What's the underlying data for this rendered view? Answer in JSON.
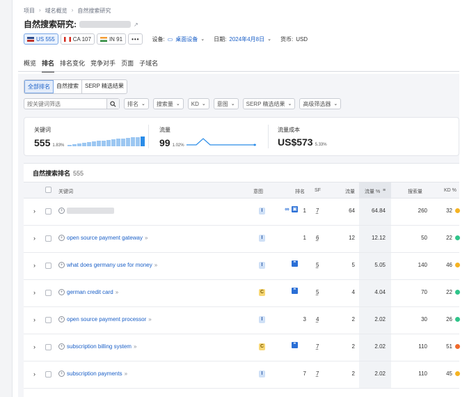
{
  "breadcrumb": [
    "项目",
    "域名概览",
    "自然搜索研究"
  ],
  "title": "自然搜索研究:",
  "databases": [
    {
      "label": "US 555",
      "flag": "us",
      "active": true
    },
    {
      "label": "CA 107",
      "flag": "ca",
      "active": false
    },
    {
      "label": "IN 91",
      "flag": "in",
      "active": false
    }
  ],
  "more_label": "•••",
  "device": {
    "label": "设备:",
    "value": "桌面设备"
  },
  "date": {
    "label": "日期:",
    "value": "2024年4月8日"
  },
  "currency": {
    "label": "货币:",
    "value": "USD"
  },
  "tabs": [
    "概览",
    "排名",
    "排名变化",
    "竞争对手",
    "页面",
    "子域名"
  ],
  "active_tab": "排名",
  "segments": [
    "全部排名",
    "自然搜索",
    "SERP 精选结果"
  ],
  "search_placeholder": "按关键词筛选",
  "filters": [
    "排名",
    "搜索量",
    "KD",
    "意图",
    "SERP 精选结果",
    "高级筛选器"
  ],
  "summary": {
    "keywords": {
      "label": "关键词",
      "value": "555",
      "pct": "1.83%",
      "bar_levels": [
        0.15,
        0.2,
        0.3,
        0.35,
        0.45,
        0.5,
        0.55,
        0.6,
        0.65,
        0.7,
        0.75,
        0.8,
        0.85,
        0.9,
        0.95,
        1.0
      ]
    },
    "traffic": {
      "label": "流量",
      "value": "99",
      "pct": "1.02%"
    },
    "traffic_cost": {
      "label": "流量成本",
      "value": "US$573",
      "pct": "5.33%"
    }
  },
  "table": {
    "title": "自然搜索排名",
    "count": "555",
    "headers": {
      "keyword": "关键词",
      "intent": "意图",
      "position": "排名",
      "sf": "SF",
      "traffic": "流量",
      "traffic_pct": "流量 %",
      "volume": "搜索量",
      "kd": "KD %"
    },
    "rows": [
      {
        "keyword": "",
        "blurred": true,
        "intent": "I",
        "sf_icons": [
          "link",
          "image"
        ],
        "position": "1",
        "sf": "7",
        "traffic": "64",
        "traffic_pct": "64.84",
        "volume": "260",
        "kd": "32",
        "kd_color": "#f5b323"
      },
      {
        "keyword": "open source payment gateway",
        "blurred": false,
        "intent": "I",
        "sf_icons": [],
        "position": "1",
        "sf": "6",
        "traffic": "12",
        "traffic_pct": "12.12",
        "volume": "50",
        "kd": "22",
        "kd_color": "#2fc48a"
      },
      {
        "keyword": "what does germany use for money",
        "blurred": false,
        "intent": "I",
        "sf_icons": [
          "quote"
        ],
        "position": "",
        "sf": "5",
        "traffic": "5",
        "traffic_pct": "5.05",
        "volume": "140",
        "kd": "46",
        "kd_color": "#f5b323"
      },
      {
        "keyword": "german credit card",
        "blurred": false,
        "intent": "C",
        "sf_icons": [
          "quote"
        ],
        "position": "",
        "sf": "5",
        "traffic": "4",
        "traffic_pct": "4.04",
        "volume": "70",
        "kd": "22",
        "kd_color": "#2fc48a"
      },
      {
        "keyword": "open source payment processor",
        "blurred": false,
        "intent": "I",
        "sf_icons": [],
        "position": "3",
        "sf": "4",
        "traffic": "2",
        "traffic_pct": "2.02",
        "volume": "30",
        "kd": "26",
        "kd_color": "#2fc48a"
      },
      {
        "keyword": "subscription billing system",
        "blurred": false,
        "intent": "C",
        "sf_icons": [
          "quote"
        ],
        "position": "",
        "sf": "7",
        "traffic": "2",
        "traffic_pct": "2.02",
        "volume": "110",
        "kd": "51",
        "kd_color": "#f06a2c"
      },
      {
        "keyword": "subscription payments",
        "blurred": false,
        "intent": "I",
        "sf_icons": [],
        "position": "7",
        "sf": "7",
        "traffic": "2",
        "traffic_pct": "2.02",
        "volume": "110",
        "kd": "45",
        "kd_color": "#f5b323"
      }
    ]
  }
}
